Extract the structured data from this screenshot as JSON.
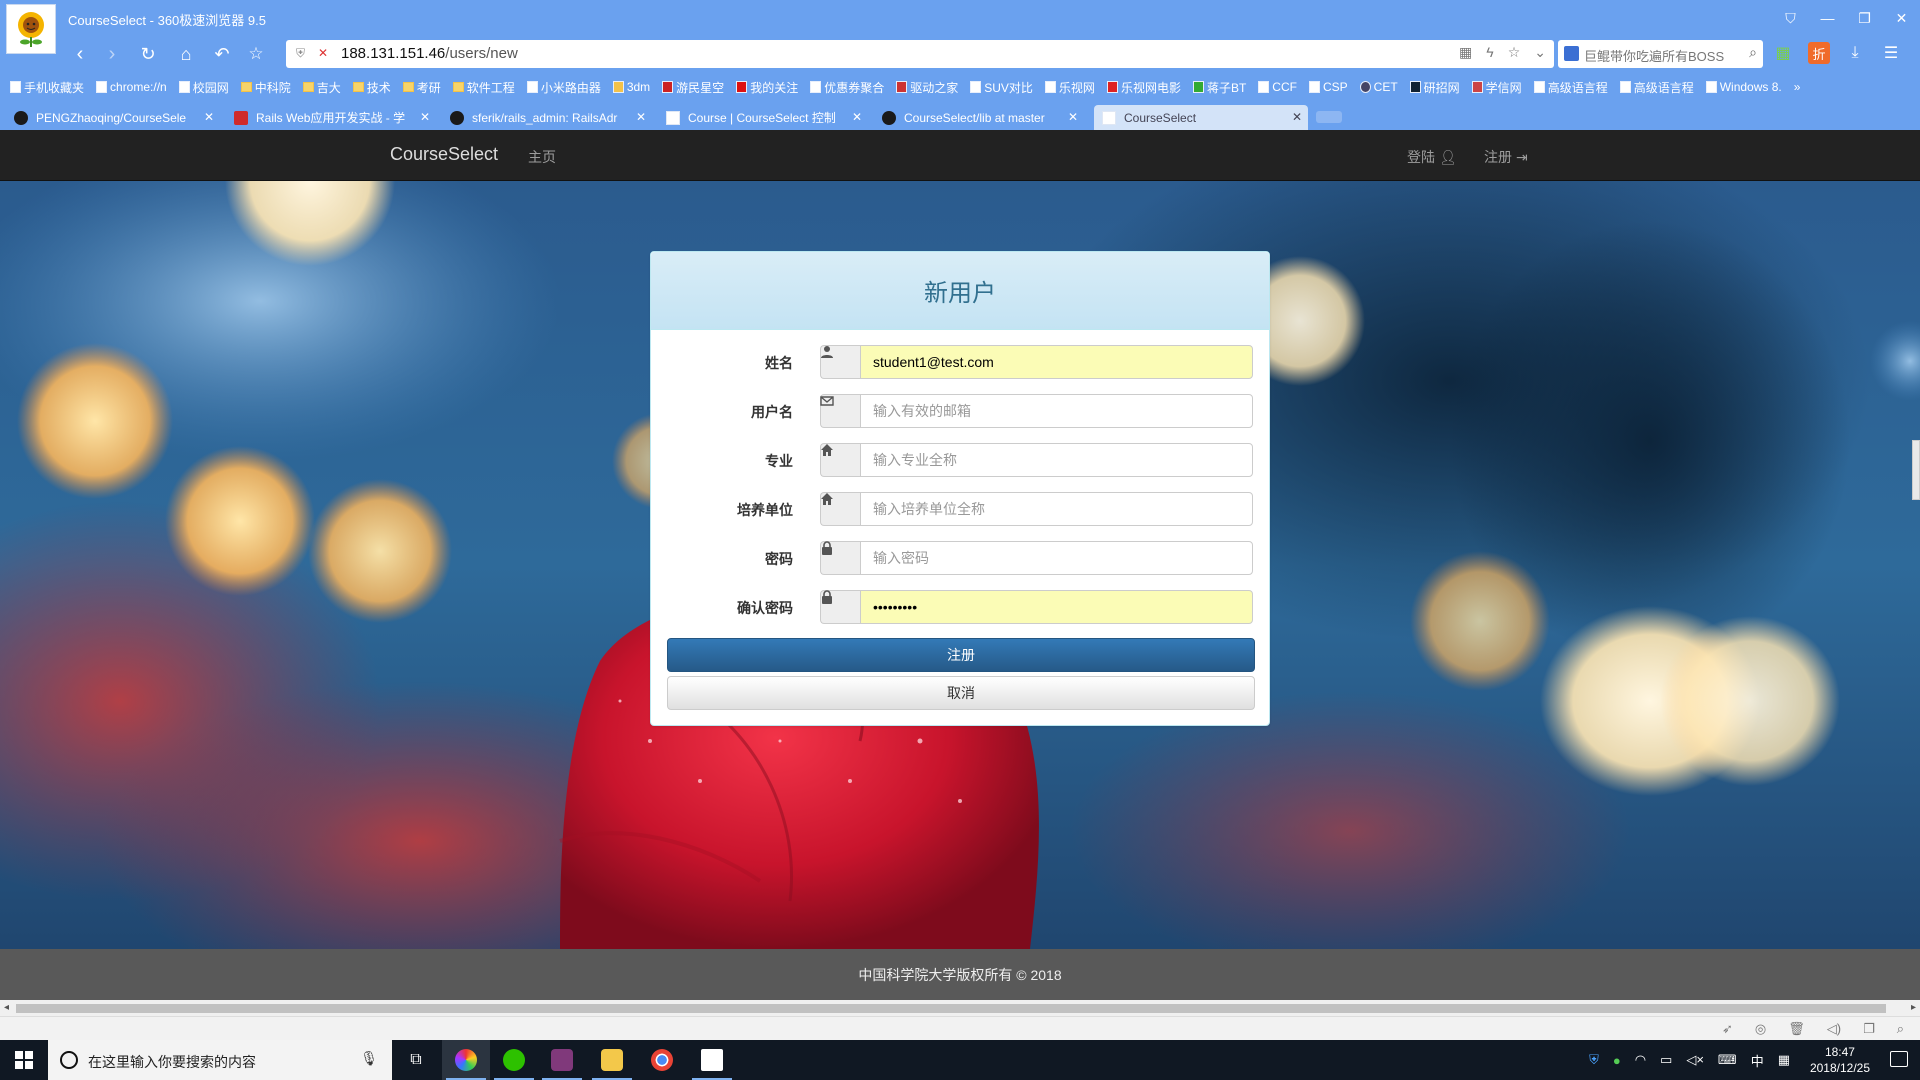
{
  "browser": {
    "window_title": "CourseSelect - 360极速浏览器 9.5",
    "url_host": "188.131.151.46",
    "url_path": "/users/new",
    "search_text": "巨鲲带你吃遍所有BOSS",
    "bookmarks": [
      "手机收藏夹",
      "chrome://n",
      "校园网",
      "中科院",
      "吉大",
      "技术",
      "考研",
      "软件工程",
      "小米路由器",
      "3dm",
      "游民星空",
      "我的关注",
      "优惠券聚合",
      "驱动之家",
      "SUV对比",
      "乐视网",
      "乐视网电影",
      "蒋子BT",
      "CCF",
      "CSP",
      "CET",
      "研招网",
      "学信网",
      "高级语言程",
      "高级语言程",
      "Windows 8."
    ],
    "tabs": [
      {
        "label": "PENGZhaoqing/CourseSele"
      },
      {
        "label": "Rails Web应用开发实战 - 学"
      },
      {
        "label": "sferik/rails_admin: RailsAdr"
      },
      {
        "label": "Course | CourseSelect 控制"
      },
      {
        "label": "CourseSelect/lib at master"
      },
      {
        "label": "CourseSelect"
      }
    ]
  },
  "site": {
    "brand": "CourseSelect",
    "nav_home": "主页",
    "nav_login": "登陆",
    "nav_register": "注册",
    "footer": "中国科学院大学版权所有 © 2018"
  },
  "form": {
    "title": "新用户",
    "fields": [
      {
        "label": "姓名",
        "value": "student1@test.com",
        "placeholder": "",
        "icon": "user-icon"
      },
      {
        "label": "用户名",
        "value": "",
        "placeholder": "输入有效的邮箱",
        "icon": "envelope-icon"
      },
      {
        "label": "专业",
        "value": "",
        "placeholder": "输入专业全称",
        "icon": "home-icon"
      },
      {
        "label": "培养单位",
        "value": "",
        "placeholder": "输入培养单位全称",
        "icon": "home-icon"
      },
      {
        "label": "密码",
        "value": "",
        "placeholder": "输入密码",
        "icon": "lock-icon"
      },
      {
        "label": "确认密码",
        "value": "•••••••••",
        "placeholder": "",
        "icon": "lock-icon"
      }
    ],
    "submit_label": "注册",
    "cancel_label": "取消"
  },
  "taskbar": {
    "search_placeholder": "在这里输入你要搜索的内容",
    "time": "18:47",
    "date": "2018/12/25",
    "ime": "中"
  },
  "colors": {
    "browser_chrome": "#6aa1ef",
    "site_navbar": "#222222",
    "panel_heading": "#d9edf7",
    "primary_button": "#337ab7",
    "autofill": "#fbfcb6",
    "footer": "#595959"
  }
}
